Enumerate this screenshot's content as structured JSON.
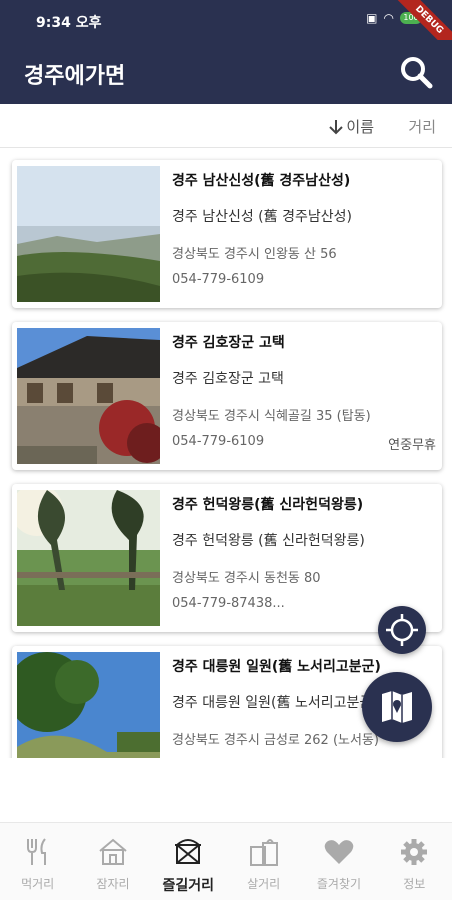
{
  "status_bar": {
    "time": "9:34 오후",
    "battery": "100",
    "debug_label": "DEBUG"
  },
  "app_bar": {
    "title": "경주에가면",
    "search_icon": "search-icon"
  },
  "sort": {
    "by_name": "이름",
    "by_distance": "거리",
    "active": "이름"
  },
  "places": [
    {
      "name": "경주 남산신성(舊 경주남산성)",
      "subtitle": "경주 남산신성 (舊 경주남산성)",
      "address": "경상북도 경주시 인왕동 산 56",
      "phone": "054-779-6109",
      "hours": ""
    },
    {
      "name": "경주 김호장군 고택",
      "subtitle": "경주 김호장군 고택",
      "address": "경상북도 경주시 식혜골길 35 (탑동)",
      "phone": "054-779-6109",
      "hours": "연중무휴"
    },
    {
      "name": "경주 헌덕왕릉(舊 신라헌덕왕릉)",
      "subtitle": "경주 헌덕왕릉 (舊 신라헌덕왕릉)",
      "address": "경상북도 경주시 동천동 80",
      "phone": "054-779-87438...",
      "hours": ""
    },
    {
      "name": "경주 대릉원 일원(舊 노서리고분군)",
      "subtitle": "경주 대릉원 일원(舊 노서리고분군)",
      "address": "경상북도 경주시 금성로 262 (노서동)",
      "phone": "",
      "hours": ""
    }
  ],
  "fab": {
    "location_icon": "crosshair-icon",
    "map_icon": "map-icon"
  },
  "bottom_nav": [
    {
      "label": "먹거리",
      "icon": "fork-knife-icon",
      "active": false
    },
    {
      "label": "잠자리",
      "icon": "house-icon",
      "active": false
    },
    {
      "label": "즐길거리",
      "icon": "tent-icon",
      "active": true
    },
    {
      "label": "살거리",
      "icon": "shopping-bag-icon",
      "active": false
    },
    {
      "label": "즐겨찾기",
      "icon": "heart-icon",
      "active": false
    },
    {
      "label": "정보",
      "icon": "gear-icon",
      "active": false
    }
  ],
  "colors": {
    "primary": "#2a3150",
    "active_text": "#222222",
    "inactive_text": "#aaaaaa"
  }
}
